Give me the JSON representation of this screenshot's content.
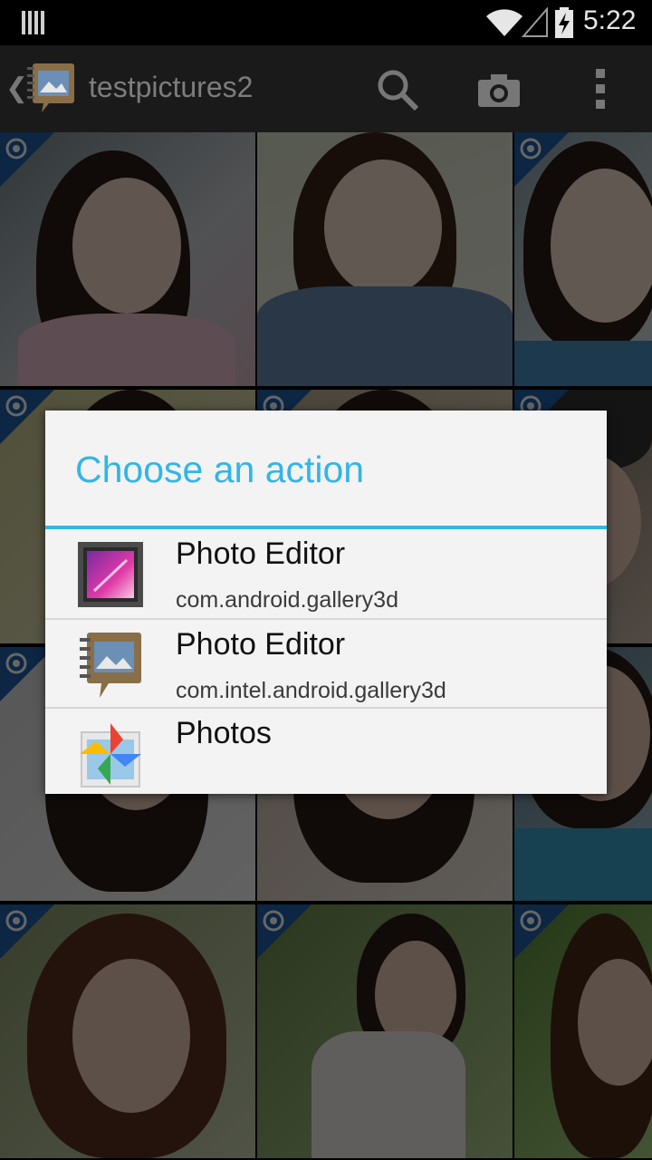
{
  "status_bar": {
    "time": "5:22",
    "icons": [
      "notification-bars-icon",
      "wifi-icon",
      "signal-icon",
      "battery-charging-icon"
    ]
  },
  "action_bar": {
    "title": "testpictures2",
    "up_glyph": "❮",
    "icons": [
      "app-logo-icon",
      "search-icon",
      "camera-icon",
      "overflow-menu-icon"
    ]
  },
  "dialog": {
    "title": "Choose an action",
    "options": [
      {
        "label": "Photo Editor",
        "package": "com.android.gallery3d",
        "icon": "gallery-icon"
      },
      {
        "label": "Photo Editor",
        "package": "com.intel.android.gallery3d",
        "icon": "intel-gallery-icon"
      },
      {
        "label": "Photos",
        "package": "",
        "icon": "google-photos-icon"
      }
    ]
  },
  "colors": {
    "accent": "#33b5e5",
    "badge": "#1f5fa8",
    "selection": "#1d8fb3"
  }
}
